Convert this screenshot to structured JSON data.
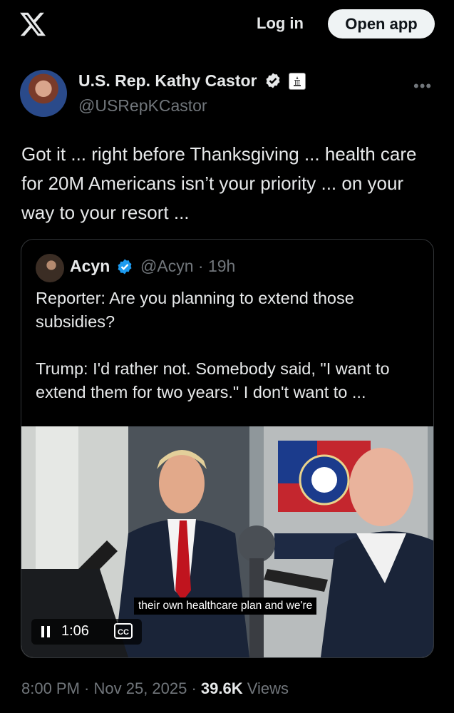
{
  "header": {
    "login_label": "Log in",
    "open_app_label": "Open app"
  },
  "tweet": {
    "author_name": "U.S. Rep. Kathy Castor",
    "handle": "@USRepKCastor",
    "text": "Got it ... right before Thanksgiving ... health care for 20M Americans isn’t your priority ... on your way to your resort ...",
    "timestamp": "8:00 PM · Nov 25, 2025 · ",
    "views_count": "39.6K",
    "views_label": " Views"
  },
  "quote": {
    "author_name": "Acyn",
    "handle_time": "@Acyn · 19h",
    "text": "Reporter: Are you planning to extend those subsidies?\n\nTrump: I'd rather not. Somebody said, \"I want to extend them for two years.\" I don't want to ...",
    "video": {
      "caption": "their own healthcare plan and we're",
      "time": "1:06",
      "cc_label": "CC"
    }
  },
  "colors": {
    "background": "#000000",
    "verified_blue": "#1d9bf0",
    "muted_text": "#71767b",
    "text": "#e7e9ea"
  },
  "icons": [
    "x-logo-icon",
    "verified-badge-icon",
    "government-badge-icon",
    "more-icon",
    "pause-icon",
    "closed-captions-icon"
  ]
}
